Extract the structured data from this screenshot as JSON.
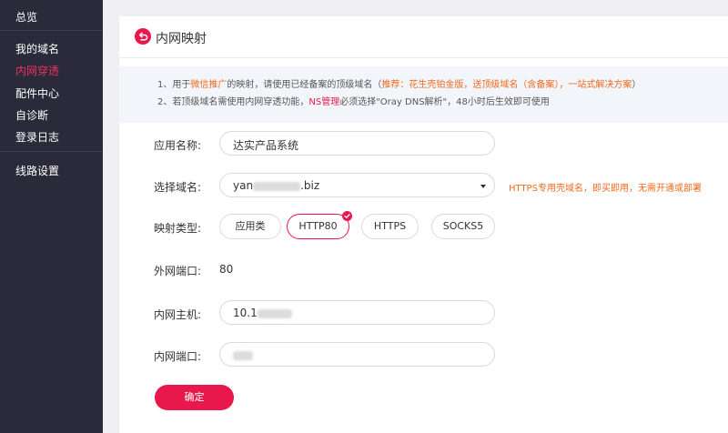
{
  "sidebar": {
    "items": [
      {
        "label": "总览",
        "active": false
      },
      {
        "label": "我的域名",
        "active": false
      },
      {
        "label": "内网穿透",
        "active": true
      },
      {
        "label": "配件中心",
        "active": false
      },
      {
        "label": "自诊断",
        "active": false
      },
      {
        "label": "登录日志",
        "active": false
      },
      {
        "label": "线路设置",
        "active": false
      }
    ]
  },
  "header": {
    "title": "内网映射",
    "back_icon": "back-arrow-icon"
  },
  "notice": {
    "line1_prefix": "1、用于",
    "line1_highlight1": "微信推广",
    "line1_mid": "的映射，请使用已经备案的顶级域名（",
    "line1_highlight2": "推荐：花生壳铂金版，送顶级域名（含备案），一站式解决方案",
    "line1_suffix": "）",
    "line2_prefix": "2、若顶级域名需使用内网穿透功能，",
    "line2_highlight": "NS管理",
    "line2_suffix": "必须选择\"Oray DNS解析\"，48小时后生效即可使用"
  },
  "form": {
    "app_name_label": "应用名称:",
    "app_name_value": "达实产品系统",
    "domain_label": "选择域名:",
    "domain_value_start": "yan",
    "domain_value_end": ".biz",
    "domain_tip": "HTTPS专用壳域名，即买即用，无需开通或部署",
    "type_label": "映射类型:",
    "types": [
      "应用类",
      "HTTP80",
      "HTTPS",
      "SOCKS5"
    ],
    "selected_type": "HTTP80",
    "external_port_label": "外网端口:",
    "external_port_value": "80",
    "internal_host_label": "内网主机:",
    "internal_host_value_start": "10.1",
    "internal_port_label": "内网端口:",
    "confirm_label": "确定"
  },
  "colors": {
    "accent": "#e8184c",
    "highlight": "#f06a1e",
    "sidebar_bg": "#2b2a3a"
  }
}
